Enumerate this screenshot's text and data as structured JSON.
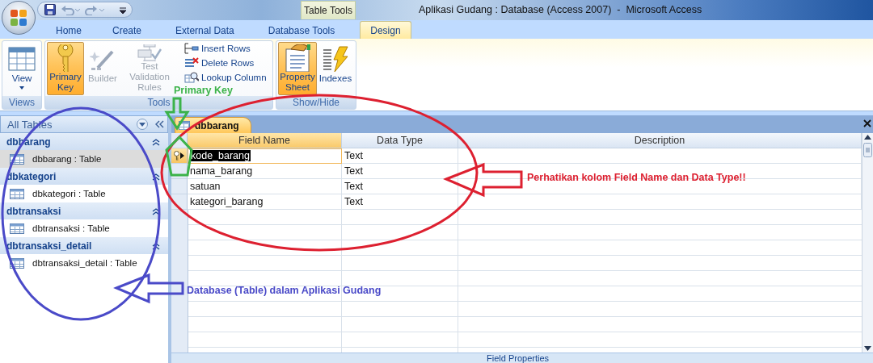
{
  "window": {
    "title": "Aplikasi Gudang : Database (Access 2007)  -  Microsoft Access",
    "contextual_tab": "Table Tools"
  },
  "ribbon_tabs": [
    {
      "label": "Home",
      "selected": false
    },
    {
      "label": "Create",
      "selected": false
    },
    {
      "label": "External Data",
      "selected": false
    },
    {
      "label": "Database Tools",
      "selected": false
    },
    {
      "label": "Design",
      "selected": true
    }
  ],
  "ribbon_groups": [
    {
      "label": "Views",
      "buttons": [
        {
          "label": "View",
          "kind": "large",
          "pressed": false,
          "disabled": false,
          "dropdown": true
        }
      ]
    },
    {
      "label": "Tools",
      "buttons": [
        {
          "label": "Primary Key",
          "kind": "large",
          "pressed": true,
          "disabled": false
        },
        {
          "label": "Builder",
          "kind": "large",
          "pressed": false,
          "disabled": true
        },
        {
          "label": "Test Validation Rules",
          "kind": "large",
          "pressed": false,
          "disabled": true
        },
        {
          "label": "Insert Rows",
          "kind": "small",
          "pressed": false,
          "disabled": false
        },
        {
          "label": "Delete Rows",
          "kind": "small",
          "pressed": false,
          "disabled": false
        },
        {
          "label": "Lookup Column",
          "kind": "small",
          "pressed": false,
          "disabled": false
        }
      ]
    },
    {
      "label": "Show/Hide",
      "buttons": [
        {
          "label": "Property Sheet",
          "kind": "large",
          "pressed": true,
          "disabled": false
        },
        {
          "label": "Indexes",
          "kind": "large",
          "pressed": false,
          "disabled": false
        }
      ]
    }
  ],
  "navigation_pane": {
    "title": "All Tables",
    "groups": [
      {
        "label": "dbbarang",
        "expanded": true,
        "items": [
          {
            "label": "dbbarang : Table",
            "selected": true
          }
        ]
      },
      {
        "label": "dbkategori",
        "expanded": true,
        "items": [
          {
            "label": "dbkategori : Table",
            "selected": false
          }
        ]
      },
      {
        "label": "dbtransaksi",
        "expanded": true,
        "items": [
          {
            "label": "dbtransaksi : Table",
            "selected": false
          }
        ]
      },
      {
        "label": "dbtransaksi_detail",
        "expanded": true,
        "items": [
          {
            "label": "dbtransaksi_detail : Table",
            "selected": false
          }
        ]
      }
    ]
  },
  "document": {
    "tab": "dbbarang",
    "columns": [
      "Field Name",
      "Data Type",
      "Description"
    ],
    "rows": [
      {
        "field_name": "kode_barang",
        "data_type": "Text",
        "primary_key": true,
        "selected": true
      },
      {
        "field_name": "nama_barang",
        "data_type": "Text",
        "primary_key": false,
        "selected": false
      },
      {
        "field_name": "satuan",
        "data_type": "Text",
        "primary_key": false,
        "selected": false
      },
      {
        "field_name": "kategori_barang",
        "data_type": "Text",
        "primary_key": false,
        "selected": false
      }
    ],
    "properties_label": "Field Properties"
  },
  "annotations": [
    {
      "text": "Primary Key",
      "color": "#3cb34a"
    },
    {
      "text": "Perhatikan kolom Field Name dan Data Type!!",
      "color": "#dd2030"
    },
    {
      "text": "Database (Table) dalam Aplikasi Gudang",
      "color": "#4a4ac8"
    }
  ]
}
